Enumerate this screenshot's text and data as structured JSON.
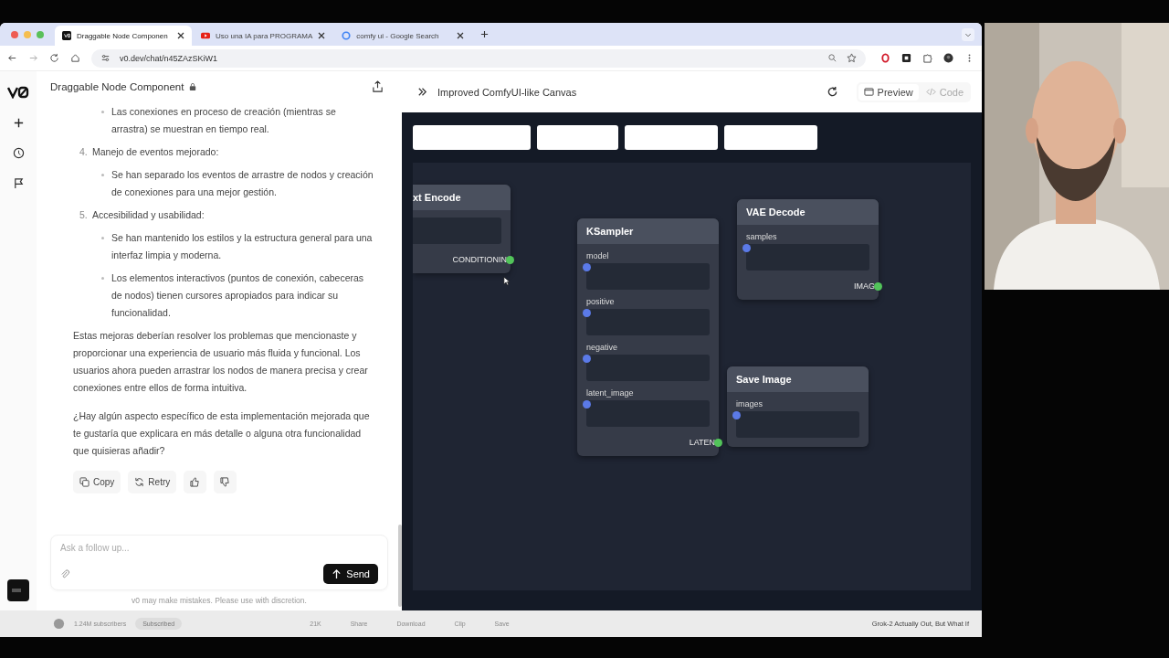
{
  "browser": {
    "tabs": [
      {
        "title": "Draggable Node Componen",
        "selected": true
      },
      {
        "title": "Uso una IA para PROGRAMA",
        "selected": false
      },
      {
        "title": "comfy ui - Google Search",
        "selected": false
      }
    ],
    "url": "v0.dev/chat/n45ZAzSKiW1"
  },
  "chat": {
    "title": "Draggable Node Component",
    "blocks": [
      {
        "kind": "bullet",
        "text": "Las conexiones en proceso de creación (mientras se arrastra) se muestran en tiempo real."
      },
      {
        "kind": "numbered",
        "number": "4.",
        "text": "Manejo de eventos mejorado:"
      },
      {
        "kind": "bullet",
        "text": "Se han separado los eventos de arrastre de nodos y creación de conexiones para una mejor gestión."
      },
      {
        "kind": "numbered",
        "number": "5.",
        "text": "Accesibilidad y usabilidad:"
      },
      {
        "kind": "bullet",
        "text": "Se han mantenido los estilos y la estructura general para una interfaz limpia y moderna."
      },
      {
        "kind": "bullet",
        "text": "Los elementos interactivos (puntos de conexión, cabeceras de nodos) tienen cursores apropiados para indicar su funcionalidad."
      },
      {
        "kind": "paragraph",
        "text": "Estas mejoras deberían resolver los problemas que mencionaste y proporcionar una experiencia de usuario más fluida y funcional. Los usuarios ahora pueden arrastrar los nodos de manera precisa y crear conexiones entre ellos de forma intuitiva."
      },
      {
        "kind": "paragraph",
        "text": "¿Hay algún aspecto específico de esta implementación mejorada que te gustaría que explicara en más detalle o alguna otra funcionalidad que quisieras añadir?"
      }
    ],
    "actions": [
      {
        "kind": "copy",
        "label": "Copy"
      },
      {
        "kind": "retry",
        "label": "Retry"
      },
      {
        "kind": "like"
      },
      {
        "kind": "dislike"
      }
    ],
    "input": {
      "placeholder": "Ask a follow up..."
    },
    "send": "Send",
    "disclaimer": "v0 may make mistakes. Please use with discretion."
  },
  "preview": {
    "title": "Improved ComfyUI-like Canvas",
    "tabs": [
      {
        "label": "Preview",
        "selected": true
      },
      {
        "label": "Code",
        "selected": false
      }
    ],
    "nodes": [
      {
        "title": "xt Encode",
        "inputs": [
          {
            "port": false
          }
        ],
        "output": "CONDITIONIN"
      },
      {
        "title": "KSampler",
        "inputs": [
          {
            "label": "model",
            "port": true
          },
          {
            "label": "positive",
            "port": true
          },
          {
            "label": "negative",
            "port": true
          },
          {
            "label": "latent_image",
            "port": true
          }
        ],
        "output": "LATEN"
      },
      {
        "title": "VAE Decode",
        "inputs": [
          {
            "label": "samples",
            "port": true
          }
        ],
        "output": "IMAG"
      },
      {
        "title": "Save Image",
        "inputs": [
          {
            "label": "images",
            "port": true
          }
        ]
      }
    ]
  },
  "background_page": {
    "subscribers": "1.24M subscribers",
    "subscribe": "Subscribed",
    "actions": [
      "21K",
      "Share",
      "Download",
      "Clip",
      "Save"
    ],
    "video_title": "Grok-2 Actually Out, But What If"
  }
}
